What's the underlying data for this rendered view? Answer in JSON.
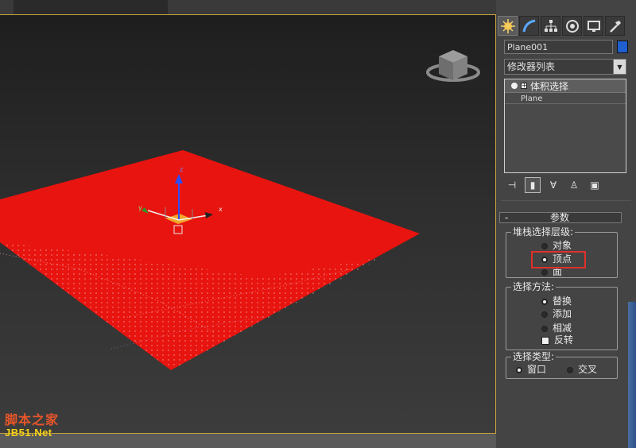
{
  "colors": {
    "plane": "#e8140f",
    "viewport_border": "#c8a43a",
    "object_color": "#1f5fcf",
    "highlight": "#e0302a"
  },
  "viewport": {
    "gizmo_axis_labels": {
      "z": "z",
      "x": "x",
      "y": "y"
    },
    "viewcube_icon": "viewcube-icon"
  },
  "panel": {
    "tabs": [
      {
        "icon": "create-icon",
        "active": true
      },
      {
        "icon": "modify-icon",
        "active": false
      },
      {
        "icon": "hierarchy-icon",
        "active": false
      },
      {
        "icon": "motion-icon",
        "active": false
      },
      {
        "icon": "display-icon",
        "active": false
      },
      {
        "icon": "utilities-icon",
        "active": false
      }
    ],
    "object_name": "Plane001",
    "modifier_list": "修改器列表",
    "stack": {
      "modifier": "体积选择",
      "base": "Plane"
    },
    "rollout_title": "参数",
    "stack_level": {
      "title": "堆栈选择层级:",
      "options": [
        "对象",
        "顶点",
        "面"
      ],
      "selected": "顶点"
    },
    "select_by": {
      "title": "选择方法:",
      "options": [
        "替换",
        "添加",
        "相减"
      ],
      "selected": "替换",
      "invert_label": "反转"
    },
    "select_type": {
      "title": "选择类型:",
      "options": [
        "窗口",
        "交叉"
      ],
      "selected": "窗口"
    }
  },
  "watermark": {
    "line1": "脚本之家",
    "line2": "JB51.Net"
  }
}
